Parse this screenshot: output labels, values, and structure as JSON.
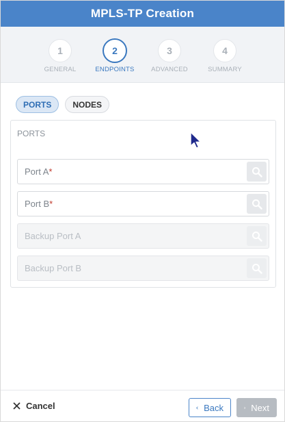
{
  "header": {
    "title": "MPLS-TP Creation"
  },
  "steps": [
    {
      "number": "1",
      "label": "GENERAL",
      "active": false
    },
    {
      "number": "2",
      "label": "ENDPOINTS",
      "active": true
    },
    {
      "number": "3",
      "label": "ADVANCED",
      "active": false
    },
    {
      "number": "4",
      "label": "SUMMARY",
      "active": false
    }
  ],
  "toggles": {
    "ports": "PORTS",
    "nodes": "NODES",
    "selected": "ports"
  },
  "panel": {
    "title": "PORTS",
    "fields": [
      {
        "placeholder": "Port A",
        "required_mark": "*",
        "value": "",
        "disabled": false,
        "icon": "search-icon"
      },
      {
        "placeholder": "Port B",
        "required_mark": "*",
        "value": "",
        "disabled": false,
        "icon": "search-icon"
      },
      {
        "placeholder": "Backup Port A",
        "required_mark": "",
        "value": "",
        "disabled": true,
        "icon": "search-icon"
      },
      {
        "placeholder": "Backup Port B",
        "required_mark": "",
        "value": "",
        "disabled": true,
        "icon": "search-icon"
      }
    ]
  },
  "footer": {
    "cancel_label": "Cancel",
    "back_label": "Back",
    "next_label": "Next"
  },
  "colors": {
    "accent": "#4a84c9",
    "active_step": "#3a78bf",
    "required": "#c0392b",
    "disabled_button": "#b7bcc2"
  }
}
